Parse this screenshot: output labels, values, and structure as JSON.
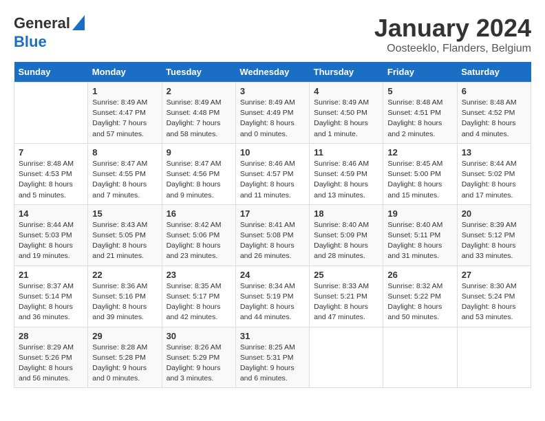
{
  "logo": {
    "line1": "General",
    "line2": "Blue"
  },
  "title": "January 2024",
  "location": "Oosteeklo, Flanders, Belgium",
  "days_of_week": [
    "Sunday",
    "Monday",
    "Tuesday",
    "Wednesday",
    "Thursday",
    "Friday",
    "Saturday"
  ],
  "weeks": [
    [
      {
        "day": "",
        "info": ""
      },
      {
        "day": "1",
        "info": "Sunrise: 8:49 AM\nSunset: 4:47 PM\nDaylight: 7 hours\nand 57 minutes."
      },
      {
        "day": "2",
        "info": "Sunrise: 8:49 AM\nSunset: 4:48 PM\nDaylight: 7 hours\nand 58 minutes."
      },
      {
        "day": "3",
        "info": "Sunrise: 8:49 AM\nSunset: 4:49 PM\nDaylight: 8 hours\nand 0 minutes."
      },
      {
        "day": "4",
        "info": "Sunrise: 8:49 AM\nSunset: 4:50 PM\nDaylight: 8 hours\nand 1 minute."
      },
      {
        "day": "5",
        "info": "Sunrise: 8:48 AM\nSunset: 4:51 PM\nDaylight: 8 hours\nand 2 minutes."
      },
      {
        "day": "6",
        "info": "Sunrise: 8:48 AM\nSunset: 4:52 PM\nDaylight: 8 hours\nand 4 minutes."
      }
    ],
    [
      {
        "day": "7",
        "info": "Sunrise: 8:48 AM\nSunset: 4:53 PM\nDaylight: 8 hours\nand 5 minutes."
      },
      {
        "day": "8",
        "info": "Sunrise: 8:47 AM\nSunset: 4:55 PM\nDaylight: 8 hours\nand 7 minutes."
      },
      {
        "day": "9",
        "info": "Sunrise: 8:47 AM\nSunset: 4:56 PM\nDaylight: 8 hours\nand 9 minutes."
      },
      {
        "day": "10",
        "info": "Sunrise: 8:46 AM\nSunset: 4:57 PM\nDaylight: 8 hours\nand 11 minutes."
      },
      {
        "day": "11",
        "info": "Sunrise: 8:46 AM\nSunset: 4:59 PM\nDaylight: 8 hours\nand 13 minutes."
      },
      {
        "day": "12",
        "info": "Sunrise: 8:45 AM\nSunset: 5:00 PM\nDaylight: 8 hours\nand 15 minutes."
      },
      {
        "day": "13",
        "info": "Sunrise: 8:44 AM\nSunset: 5:02 PM\nDaylight: 8 hours\nand 17 minutes."
      }
    ],
    [
      {
        "day": "14",
        "info": "Sunrise: 8:44 AM\nSunset: 5:03 PM\nDaylight: 8 hours\nand 19 minutes."
      },
      {
        "day": "15",
        "info": "Sunrise: 8:43 AM\nSunset: 5:05 PM\nDaylight: 8 hours\nand 21 minutes."
      },
      {
        "day": "16",
        "info": "Sunrise: 8:42 AM\nSunset: 5:06 PM\nDaylight: 8 hours\nand 23 minutes."
      },
      {
        "day": "17",
        "info": "Sunrise: 8:41 AM\nSunset: 5:08 PM\nDaylight: 8 hours\nand 26 minutes."
      },
      {
        "day": "18",
        "info": "Sunrise: 8:40 AM\nSunset: 5:09 PM\nDaylight: 8 hours\nand 28 minutes."
      },
      {
        "day": "19",
        "info": "Sunrise: 8:40 AM\nSunset: 5:11 PM\nDaylight: 8 hours\nand 31 minutes."
      },
      {
        "day": "20",
        "info": "Sunrise: 8:39 AM\nSunset: 5:12 PM\nDaylight: 8 hours\nand 33 minutes."
      }
    ],
    [
      {
        "day": "21",
        "info": "Sunrise: 8:37 AM\nSunset: 5:14 PM\nDaylight: 8 hours\nand 36 minutes."
      },
      {
        "day": "22",
        "info": "Sunrise: 8:36 AM\nSunset: 5:16 PM\nDaylight: 8 hours\nand 39 minutes."
      },
      {
        "day": "23",
        "info": "Sunrise: 8:35 AM\nSunset: 5:17 PM\nDaylight: 8 hours\nand 42 minutes."
      },
      {
        "day": "24",
        "info": "Sunrise: 8:34 AM\nSunset: 5:19 PM\nDaylight: 8 hours\nand 44 minutes."
      },
      {
        "day": "25",
        "info": "Sunrise: 8:33 AM\nSunset: 5:21 PM\nDaylight: 8 hours\nand 47 minutes."
      },
      {
        "day": "26",
        "info": "Sunrise: 8:32 AM\nSunset: 5:22 PM\nDaylight: 8 hours\nand 50 minutes."
      },
      {
        "day": "27",
        "info": "Sunrise: 8:30 AM\nSunset: 5:24 PM\nDaylight: 8 hours\nand 53 minutes."
      }
    ],
    [
      {
        "day": "28",
        "info": "Sunrise: 8:29 AM\nSunset: 5:26 PM\nDaylight: 8 hours\nand 56 minutes."
      },
      {
        "day": "29",
        "info": "Sunrise: 8:28 AM\nSunset: 5:28 PM\nDaylight: 9 hours\nand 0 minutes."
      },
      {
        "day": "30",
        "info": "Sunrise: 8:26 AM\nSunset: 5:29 PM\nDaylight: 9 hours\nand 3 minutes."
      },
      {
        "day": "31",
        "info": "Sunrise: 8:25 AM\nSunset: 5:31 PM\nDaylight: 9 hours\nand 6 minutes."
      },
      {
        "day": "",
        "info": ""
      },
      {
        "day": "",
        "info": ""
      },
      {
        "day": "",
        "info": ""
      }
    ]
  ]
}
